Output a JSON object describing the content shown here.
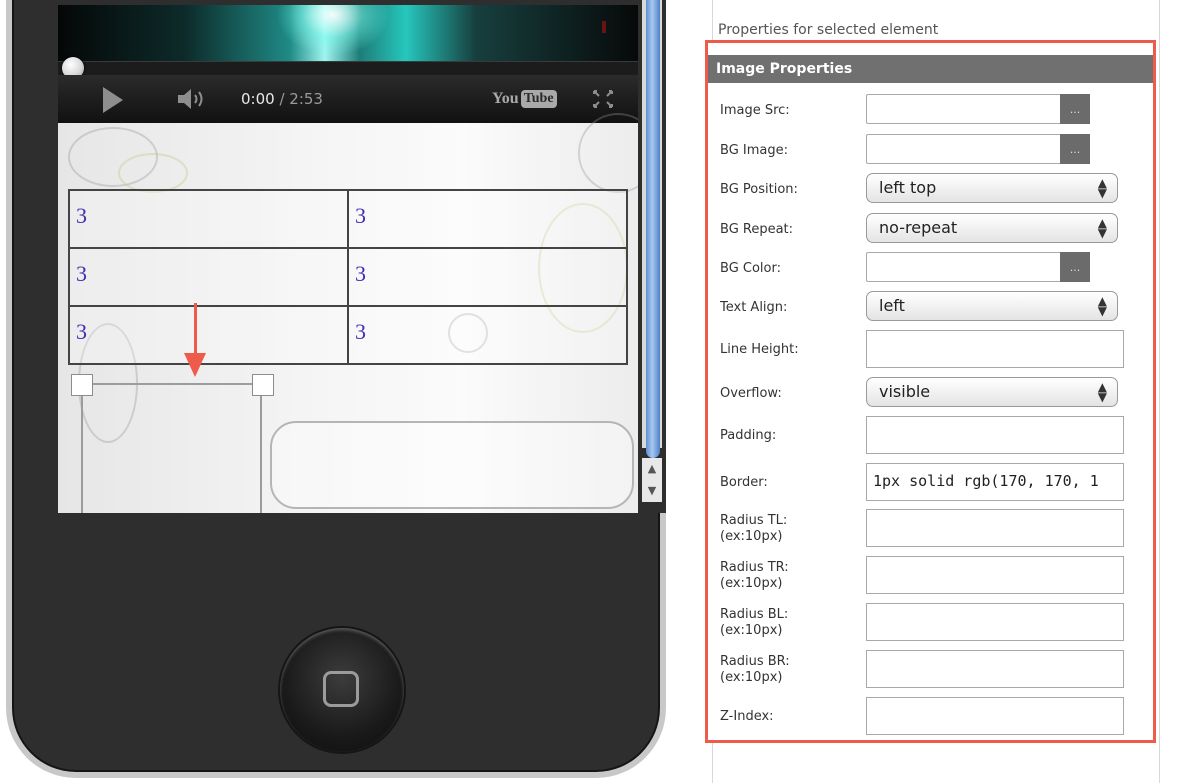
{
  "video": {
    "time_current": "0:00",
    "time_separator": " / ",
    "time_total": "2:53",
    "logo_you": "You",
    "logo_tube": "Tube"
  },
  "table": {
    "rows": [
      [
        "3",
        "3"
      ],
      [
        "3",
        "3"
      ],
      [
        "3",
        "3"
      ]
    ]
  },
  "panel": {
    "caption": "Properties for selected element",
    "header": "Image Properties",
    "image_src": {
      "label": "Image Src:",
      "value": "",
      "browse": "..."
    },
    "bg_image": {
      "label": "BG Image:",
      "value": "",
      "browse": "..."
    },
    "bg_position": {
      "label": "BG Position:",
      "value": "left top"
    },
    "bg_repeat": {
      "label": "BG Repeat:",
      "value": "no-repeat"
    },
    "bg_color": {
      "label": "BG Color:",
      "value": "",
      "browse": "..."
    },
    "text_align": {
      "label": "Text Align:",
      "value": "left"
    },
    "line_height": {
      "label": "Line Height:",
      "value": ""
    },
    "overflow": {
      "label": "Overflow:",
      "value": "visible"
    },
    "padding": {
      "label": "Padding:",
      "value": ""
    },
    "border": {
      "label": "Border:",
      "value": "1px solid rgb(170, 170, 1"
    },
    "radius_tl": {
      "label": "Radius TL:",
      "hint": "(ex:10px)",
      "value": ""
    },
    "radius_tr": {
      "label": "Radius TR:",
      "hint": "(ex:10px)",
      "value": ""
    },
    "radius_bl": {
      "label": "Radius BL:",
      "hint": "(ex:10px)",
      "value": ""
    },
    "radius_br": {
      "label": "Radius BR:",
      "hint": "(ex:10px)",
      "value": ""
    },
    "z_index": {
      "label": "Z-Index:",
      "value": ""
    }
  },
  "colors": {
    "highlight": "#ef5b4b",
    "header_bg": "#707070",
    "table_text": "#3f2fb3"
  },
  "icons": {
    "play": "play-icon",
    "volume": "volume-icon",
    "fullscreen": "fullscreen-icon",
    "home": "home-button-icon",
    "arrow": "down-arrow-icon"
  }
}
